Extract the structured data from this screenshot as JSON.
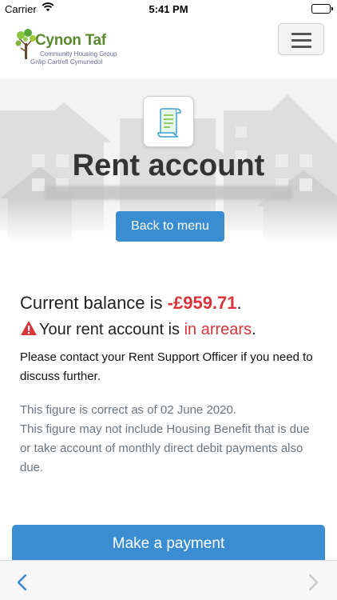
{
  "status_bar": {
    "carrier": "Carrier",
    "time": "5:41 PM"
  },
  "header": {
    "logo_brand": "Cynon Taf",
    "logo_line1": "Community Housing Group",
    "logo_line2": "Grŵp Cartrefi Cymunedol",
    "menu_icon": "hamburger-icon"
  },
  "hero": {
    "icon": "document-scroll-icon",
    "title": "Rent account",
    "back_button": "Back to menu"
  },
  "account": {
    "balance_prefix": "Current balance is ",
    "balance_amount": "-£959.71",
    "balance_suffix": ".",
    "status_prefix": "Your rent account is ",
    "status_value": "in arrears",
    "status_suffix": ".",
    "contact_text": "Please contact your Rent Support Officer if you need to discuss further.",
    "note_line1": "This figure is correct as of 02 June 2020.",
    "note_line2": "This figure may not include Housing Benefit that is due or take account of monthly direct debit payments also due."
  },
  "actions": {
    "pay_button": "Make a payment"
  },
  "colors": {
    "accent": "#3a8dd0",
    "danger": "#d9343a"
  }
}
